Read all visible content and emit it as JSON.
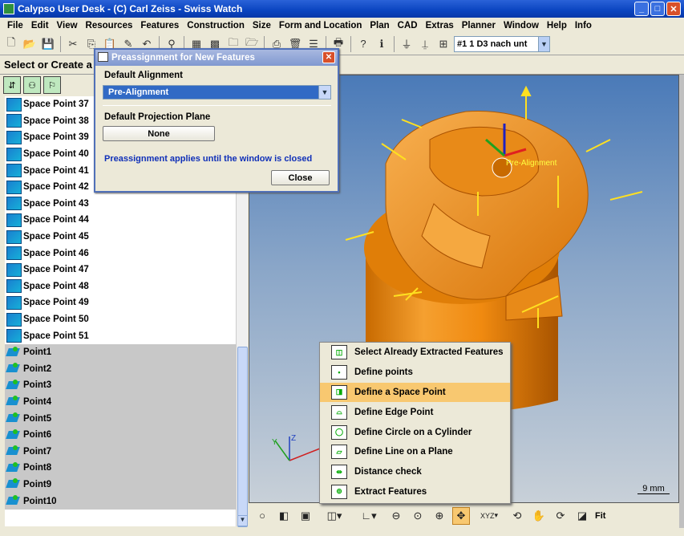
{
  "window": {
    "title": "Calypso User Desk - (C) Carl Zeiss - Swiss Watch"
  },
  "menu": [
    "File",
    "Edit",
    "View",
    "Resources",
    "Features",
    "Construction",
    "Size",
    "Form and Location",
    "Plan",
    "CAD",
    "Extras",
    "Planner",
    "Window",
    "Help",
    "Info"
  ],
  "toolbar": {
    "plan_combo": "#1     1 D3 nach unt"
  },
  "select_bar": {
    "text": "Select or Create a"
  },
  "features": [
    {
      "name": "Space Point 37",
      "type": "space-point"
    },
    {
      "name": "Space Point 38",
      "type": "space-point"
    },
    {
      "name": "Space Point 39",
      "type": "space-point"
    },
    {
      "name": "Space Point 40",
      "type": "space-point"
    },
    {
      "name": "Space Point 41",
      "type": "space-point"
    },
    {
      "name": "Space Point 42",
      "type": "space-point"
    },
    {
      "name": "Space Point 43",
      "type": "space-point"
    },
    {
      "name": "Space Point 44",
      "type": "space-point"
    },
    {
      "name": "Space Point 45",
      "type": "space-point"
    },
    {
      "name": "Space Point 46",
      "type": "space-point"
    },
    {
      "name": "Space Point 47",
      "type": "space-point"
    },
    {
      "name": "Space Point 48",
      "type": "space-point"
    },
    {
      "name": "Space Point 49",
      "type": "space-point"
    },
    {
      "name": "Space Point 50",
      "type": "space-point"
    },
    {
      "name": "Space Point 51",
      "type": "space-point"
    },
    {
      "name": "Point1",
      "type": "point"
    },
    {
      "name": "Point2",
      "type": "point"
    },
    {
      "name": "Point3",
      "type": "point"
    },
    {
      "name": "Point4",
      "type": "point"
    },
    {
      "name": "Point5",
      "type": "point"
    },
    {
      "name": "Point6",
      "type": "point"
    },
    {
      "name": "Point7",
      "type": "point"
    },
    {
      "name": "Point8",
      "type": "point"
    },
    {
      "name": "Point9",
      "type": "point"
    },
    {
      "name": "Point10",
      "type": "point"
    }
  ],
  "dialog": {
    "title": "Preassignment for New Features",
    "alignment_label": "Default Alignment",
    "alignment_value": "Pre-Alignment",
    "projection_label": "Default Projection Plane",
    "projection_value": "None",
    "note": "Preassignment applies until the window is closed",
    "close_label": "Close"
  },
  "viewport": {
    "alignment_tag": "Pre-Alignment",
    "scale": "9 mm",
    "axis_z": "Z",
    "axis_y": "Y"
  },
  "popup_menu": {
    "items": [
      "Select Already Extracted Features",
      "Define points",
      "Define a Space Point",
      "Define Edge Point",
      "Define Circle on a Cylinder",
      "Define Line on a Plane",
      "Distance check",
      "Extract Features"
    ],
    "selected_index": 2
  },
  "bottombar": {
    "fit_label": "Fit",
    "xyz_label": "XYZ"
  },
  "colors": {
    "part": "#f08a10",
    "selection": "#f8c870",
    "dialog_text": "#1030b8"
  }
}
